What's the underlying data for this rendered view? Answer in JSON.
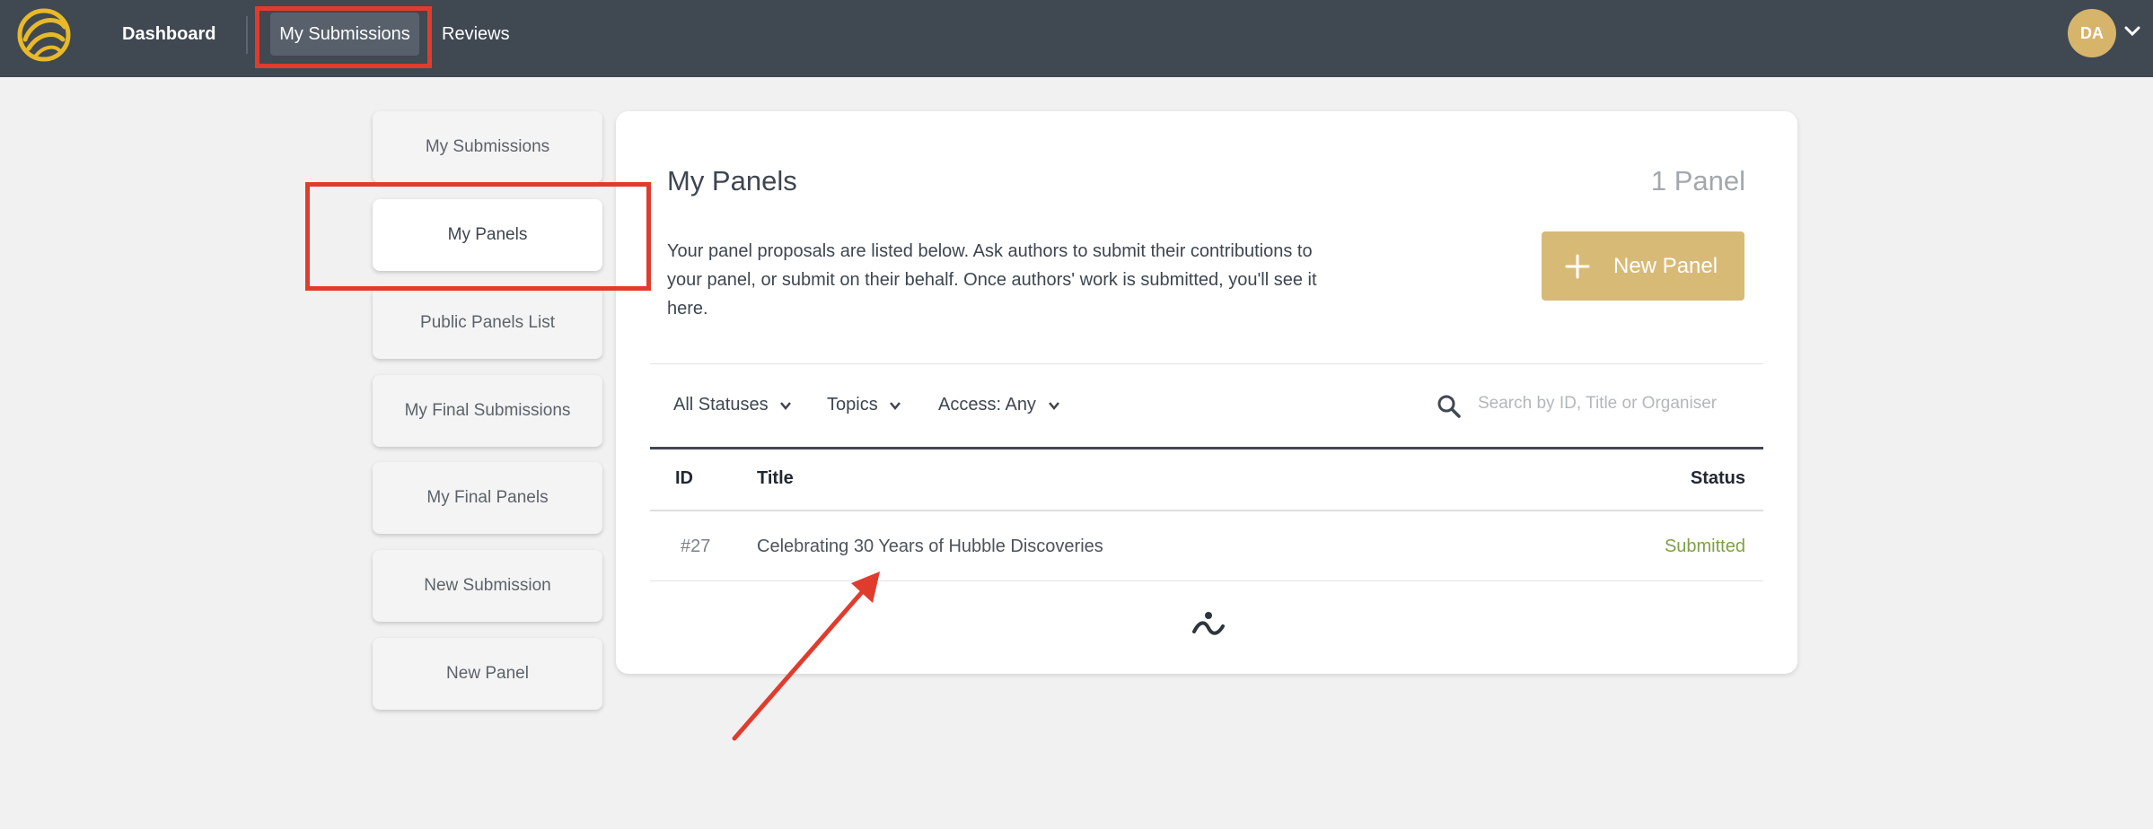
{
  "topbar": {
    "logo_icon": "yellow-swirl-logo",
    "nav": {
      "dashboard": "Dashboard",
      "my_submissions": "My Submissions",
      "reviews": "Reviews"
    },
    "user": {
      "initials": "DA",
      "menu_icon": "chevron-down-icon"
    }
  },
  "sidebar": {
    "items": [
      {
        "label": "My Submissions",
        "active": false
      },
      {
        "label": "My Panels",
        "active": true
      },
      {
        "label": "Public Panels List",
        "active": false
      },
      {
        "label": "My Final Submissions",
        "active": false
      },
      {
        "label": "My Final Panels",
        "active": false
      },
      {
        "label": "New Submission",
        "active": false
      },
      {
        "label": "New Panel",
        "active": false
      }
    ]
  },
  "main": {
    "title": "My Panels",
    "count": "1 Panel",
    "description": "Your panel proposals are listed below. Ask authors to submit their contributions to your panel, or submit on their behalf. Once authors' work is submitted, you'll see it here.",
    "new_panel_button": "New Panel",
    "filters": {
      "status": "All Statuses",
      "topics": "Topics",
      "access": "Access: Any"
    },
    "search": {
      "placeholder": "Search by ID, Title or Organiser"
    },
    "table": {
      "columns": {
        "id": "ID",
        "title": "Title",
        "status": "Status"
      },
      "rows": [
        {
          "id": "#27",
          "title": "Celebrating 30 Years of Hubble Discoveries",
          "status": "Submitted"
        }
      ]
    }
  },
  "colors": {
    "topbar": "#404852",
    "accent_gold": "#d8ba77",
    "status_submitted": "#7ea046",
    "annotation_red": "#e03c2e"
  }
}
